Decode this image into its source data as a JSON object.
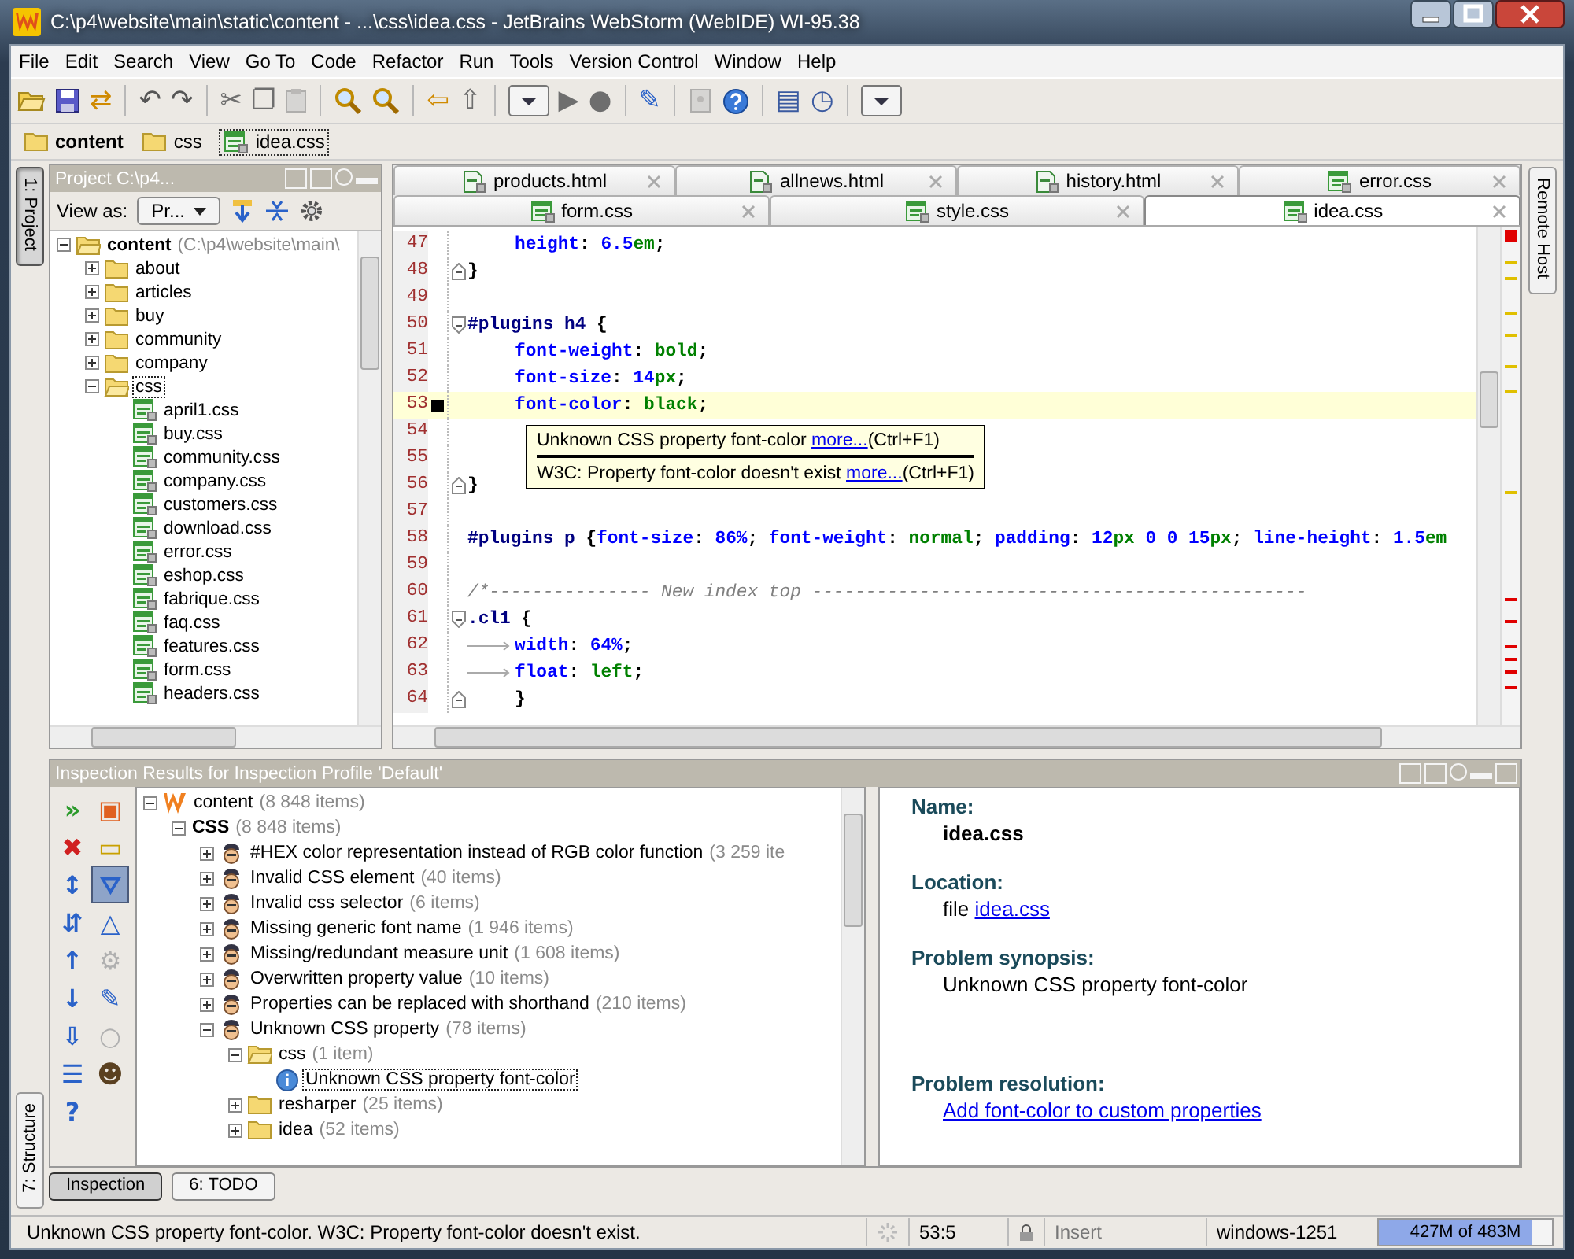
{
  "window": {
    "title": "C:\\p4\\website\\main\\static\\content - ...\\css\\idea.css - JetBrains WebStorm (WebIDE) WI-95.38"
  },
  "menu": [
    "File",
    "Edit",
    "Search",
    "View",
    "Go To",
    "Code",
    "Refactor",
    "Run",
    "Tools",
    "Version Control",
    "Window",
    "Help"
  ],
  "toolbar": [
    {
      "kind": "folder",
      "disabled": false
    },
    {
      "kind": "floppy",
      "disabled": false
    },
    {
      "kind": "glyph",
      "glyph": "⇄",
      "disabled": false
    },
    {
      "kind": "separator"
    },
    {
      "kind": "glyph",
      "glyph": "↶",
      "disabled": false
    },
    {
      "kind": "glyph",
      "glyph": "↷",
      "disabled": false
    },
    {
      "kind": "separator"
    },
    {
      "kind": "glyph",
      "glyph": "✂",
      "disabled": true
    },
    {
      "kind": "glyph",
      "glyph": "❐",
      "disabled": true
    },
    {
      "kind": "clipboard",
      "disabled": true
    },
    {
      "kind": "separator"
    },
    {
      "kind": "magnifier",
      "disabled": false
    },
    {
      "kind": "magnifier",
      "disabled": false
    },
    {
      "kind": "separator"
    },
    {
      "kind": "glyph",
      "glyph": "⇦",
      "disabled": false
    },
    {
      "kind": "glyph",
      "glyph": "⇧",
      "disabled": true
    },
    {
      "kind": "separator"
    },
    {
      "kind": "dropdown",
      "disabled": false
    },
    {
      "kind": "glyph",
      "glyph": "▶",
      "disabled": true
    },
    {
      "kind": "glyph",
      "glyph": "●",
      "disabled": true
    },
    {
      "kind": "separator"
    },
    {
      "kind": "glyph",
      "glyph": "✎",
      "disabled": false
    },
    {
      "kind": "separator"
    },
    {
      "kind": "document",
      "disabled": true
    },
    {
      "kind": "help",
      "disabled": false
    },
    {
      "kind": "separator"
    },
    {
      "kind": "glyph",
      "glyph": "▤",
      "disabled": false
    },
    {
      "kind": "glyph",
      "glyph": "◷",
      "disabled": false
    },
    {
      "kind": "separator"
    },
    {
      "kind": "dropdown",
      "disabled": false
    }
  ],
  "breadcrumbs": [
    {
      "label": "content",
      "kind": "folder"
    },
    {
      "label": "css",
      "kind": "folder"
    },
    {
      "label": "idea.css",
      "kind": "file"
    }
  ],
  "side_tabs": {
    "left_top": {
      "label": "1: Project",
      "selected": true
    },
    "left_bottom": {
      "label": "7: Structure",
      "selected": false
    },
    "right": {
      "label": "Remote Host",
      "selected": false
    }
  },
  "project": {
    "title": "Project C:\\p4...",
    "view_as_label": "View as:",
    "view_as_value": "Pr...",
    "tree": [
      {
        "label": "content",
        "path": "(C:\\p4\\website\\main\\",
        "kind": "folder",
        "expanded": true,
        "selected": false,
        "children": [
          {
            "label": "about",
            "kind": "folder",
            "expanded": false,
            "selected": false
          },
          {
            "label": "articles",
            "kind": "folder",
            "expanded": false,
            "selected": false
          },
          {
            "label": "buy",
            "kind": "folder",
            "expanded": false,
            "selected": false
          },
          {
            "label": "community",
            "kind": "folder",
            "expanded": false,
            "selected": false
          },
          {
            "label": "company",
            "kind": "folder",
            "expanded": false,
            "selected": false
          },
          {
            "label": "css",
            "kind": "folder",
            "expanded": true,
            "selected": true,
            "children": [
              {
                "label": "april1.css",
                "kind": "file",
                "selected": false
              },
              {
                "label": "buy.css",
                "kind": "file",
                "selected": false
              },
              {
                "label": "community.css",
                "kind": "file",
                "selected": false
              },
              {
                "label": "company.css",
                "kind": "file",
                "selected": false
              },
              {
                "label": "customers.css",
                "kind": "file",
                "selected": false
              },
              {
                "label": "download.css",
                "kind": "file",
                "selected": false
              },
              {
                "label": "error.css",
                "kind": "file",
                "selected": false
              },
              {
                "label": "eshop.css",
                "kind": "file",
                "selected": false
              },
              {
                "label": "fabrique.css",
                "kind": "file",
                "selected": false
              },
              {
                "label": "faq.css",
                "kind": "file",
                "selected": false
              },
              {
                "label": "features.css",
                "kind": "file",
                "selected": false
              },
              {
                "label": "form.css",
                "kind": "file",
                "selected": false
              },
              {
                "label": "headers.css",
                "kind": "file",
                "selected": false
              }
            ]
          }
        ]
      }
    ]
  },
  "editor": {
    "tab_rows": [
      [
        {
          "label": "products.html",
          "kind": "html",
          "selected": false
        },
        {
          "label": "allnews.html",
          "kind": "html",
          "selected": false
        },
        {
          "label": "history.html",
          "kind": "html",
          "selected": false
        },
        {
          "label": "error.css",
          "kind": "css",
          "selected": false
        }
      ],
      [
        {
          "label": "form.css",
          "kind": "css",
          "selected": false
        },
        {
          "label": "style.css",
          "kind": "css",
          "selected": false
        },
        {
          "label": "idea.css",
          "kind": "css",
          "selected": true
        }
      ]
    ],
    "lines": [
      {
        "number": "47",
        "indented": true,
        "segments": [
          {
            "kind": "prop",
            "text": "height"
          },
          {
            "kind": "punct",
            "text": ": "
          },
          {
            "kind": "num",
            "text": "6.5"
          },
          {
            "kind": "val",
            "text": "em"
          },
          {
            "kind": "punct",
            "text": ";"
          }
        ]
      },
      {
        "number": "48",
        "fold_end": true,
        "segments": [
          {
            "kind": "punct",
            "text": "}"
          }
        ]
      },
      {
        "number": "49"
      },
      {
        "number": "50",
        "fold_start": true,
        "segments": [
          {
            "kind": "sel",
            "text": "#plugins h4"
          },
          {
            "kind": "punct",
            "text": " {"
          }
        ]
      },
      {
        "number": "51",
        "indented": true,
        "segments": [
          {
            "kind": "prop",
            "text": "font-weight"
          },
          {
            "kind": "punct",
            "text": ": "
          },
          {
            "kind": "val",
            "text": "bold"
          },
          {
            "kind": "punct",
            "text": ";"
          }
        ]
      },
      {
        "number": "52",
        "indented": true,
        "segments": [
          {
            "kind": "prop",
            "text": "font-size"
          },
          {
            "kind": "punct",
            "text": ": "
          },
          {
            "kind": "num",
            "text": "14"
          },
          {
            "kind": "val",
            "text": "px"
          },
          {
            "kind": "punct",
            "text": ";"
          }
        ]
      },
      {
        "number": "53",
        "indented": true,
        "current": true,
        "segments": [
          {
            "kind": "prop",
            "text": "font-color"
          },
          {
            "kind": "punct",
            "text": ": "
          },
          {
            "kind": "val",
            "text": "black"
          },
          {
            "kind": "punct",
            "text": ";"
          }
        ]
      },
      {
        "number": "54"
      },
      {
        "number": "55"
      },
      {
        "number": "56",
        "fold_end": true,
        "segments": [
          {
            "kind": "punct",
            "text": "}"
          }
        ]
      },
      {
        "number": "57"
      },
      {
        "number": "58",
        "segments": [
          {
            "kind": "sel",
            "text": "#plugins p"
          },
          {
            "kind": "punct",
            "text": " {"
          },
          {
            "kind": "prop",
            "text": "font-size"
          },
          {
            "kind": "punct",
            "text": ": "
          },
          {
            "kind": "num",
            "text": "86%"
          },
          {
            "kind": "punct",
            "text": "; "
          },
          {
            "kind": "prop",
            "text": "font-weight"
          },
          {
            "kind": "punct",
            "text": ": "
          },
          {
            "kind": "val",
            "text": "normal"
          },
          {
            "kind": "punct",
            "text": "; "
          },
          {
            "kind": "prop",
            "text": "padding"
          },
          {
            "kind": "punct",
            "text": ": "
          },
          {
            "kind": "num",
            "text": "12"
          },
          {
            "kind": "val",
            "text": "px "
          },
          {
            "kind": "num",
            "text": "0 0 15"
          },
          {
            "kind": "val",
            "text": "px"
          },
          {
            "kind": "punct",
            "text": "; "
          },
          {
            "kind": "prop",
            "text": "line-height"
          },
          {
            "kind": "punct",
            "text": ": "
          },
          {
            "kind": "num",
            "text": "1.5"
          },
          {
            "kind": "val",
            "text": "em"
          }
        ]
      },
      {
        "number": "59"
      },
      {
        "number": "60",
        "segments": [
          {
            "kind": "comment",
            "text": "/*--------------- New index top ----------------------------------------------"
          }
        ]
      },
      {
        "number": "61",
        "fold_start": true,
        "segments": [
          {
            "kind": "sel",
            "text": ".cl1"
          },
          {
            "kind": "punct",
            "text": " {"
          }
        ]
      },
      {
        "number": "62",
        "tab": true,
        "segments": [
          {
            "kind": "prop",
            "text": "width"
          },
          {
            "kind": "punct",
            "text": ": "
          },
          {
            "kind": "num",
            "text": "64%"
          },
          {
            "kind": "punct",
            "text": ";"
          }
        ]
      },
      {
        "number": "63",
        "tab": true,
        "segments": [
          {
            "kind": "prop",
            "text": "float"
          },
          {
            "kind": "punct",
            "text": ": "
          },
          {
            "kind": "val",
            "text": "left"
          },
          {
            "kind": "punct",
            "text": ";"
          }
        ]
      },
      {
        "number": "64",
        "indented": true,
        "fold_end": true,
        "segments": [
          {
            "kind": "punct",
            "text": "}"
          }
        ]
      }
    ],
    "tooltip": [
      {
        "text": "Unknown CSS property font-color",
        "link": "more...",
        "shortcut": "(Ctrl+F1)"
      },
      {
        "text": "W3C: Property font-color doesn't exist",
        "link": "more...",
        "shortcut": "(Ctrl+F1)"
      }
    ]
  },
  "inspection": {
    "title": "Inspection Results for Inspection Profile 'Default'",
    "tools": [
      {
        "glyph": "»",
        "disabled": false,
        "selected": false
      },
      {
        "glyph": "▣",
        "disabled": false,
        "selected": false
      },
      {
        "glyph": "✖",
        "disabled": false,
        "selected": false
      },
      {
        "glyph": "▭",
        "disabled": false,
        "selected": false
      },
      {
        "glyph": "↕",
        "disabled": false,
        "selected": false
      },
      {
        "glyph": "⛛",
        "disabled": false,
        "selected": true
      },
      {
        "glyph": "⇵",
        "disabled": false,
        "selected": false
      },
      {
        "glyph": "△",
        "disabled": false,
        "selected": false
      },
      {
        "glyph": "↑",
        "disabled": false,
        "selected": false
      },
      {
        "glyph": "⚙",
        "disabled": true,
        "selected": false
      },
      {
        "glyph": "↓",
        "disabled": false,
        "selected": false
      },
      {
        "glyph": "✎",
        "disabled": false,
        "selected": false
      },
      {
        "glyph": "⇩",
        "disabled": false,
        "selected": false
      },
      {
        "glyph": "○",
        "disabled": true,
        "selected": false
      },
      {
        "glyph": "☰",
        "disabled": false,
        "selected": false
      },
      {
        "glyph": "☻",
        "disabled": false,
        "selected": false
      },
      {
        "glyph": "?",
        "disabled": false,
        "selected": false
      }
    ],
    "tree": [
      {
        "label": "content",
        "count": "(8 848 items)",
        "kind": "root",
        "expanded": true,
        "selected": false,
        "children": [
          {
            "label": "CSS",
            "count": "(8 848 items)",
            "kind": "group",
            "expanded": true,
            "selected": false,
            "children": [
              {
                "label": "#HEX color representation instead of RGB color function",
                "count": "(3 259 ite",
                "kind": "inspection",
                "expanded": false,
                "selected": false
              },
              {
                "label": "Invalid CSS element",
                "count": "(40 items)",
                "kind": "inspection",
                "expanded": false,
                "selected": false
              },
              {
                "label": "Invalid css selector",
                "count": "(6 items)",
                "kind": "inspection",
                "expanded": false,
                "selected": false
              },
              {
                "label": "Missing generic font name",
                "count": "(1 946 items)",
                "kind": "inspection",
                "expanded": false,
                "selected": false
              },
              {
                "label": "Missing/redundant measure unit",
                "count": "(1 608 items)",
                "kind": "inspection",
                "expanded": false,
                "selected": false
              },
              {
                "label": "Overwritten property value",
                "count": "(10 items)",
                "kind": "inspection",
                "expanded": false,
                "selected": false
              },
              {
                "label": "Properties can be replaced with shorthand",
                "count": "(210 items)",
                "kind": "inspection",
                "expanded": false,
                "selected": false
              },
              {
                "label": "Unknown CSS property",
                "count": "(78 items)",
                "kind": "inspection",
                "expanded": true,
                "selected": false,
                "children": [
                  {
                    "label": "css",
                    "count": "(1 item)",
                    "kind": "folder",
                    "expanded": true,
                    "selected": false,
                    "children": [
                      {
                        "label": "Unknown CSS property font-color",
                        "kind": "problem",
                        "selected": true
                      }
                    ]
                  },
                  {
                    "label": "resharper",
                    "count": "(25 items)",
                    "kind": "folder",
                    "expanded": false,
                    "selected": false
                  },
                  {
                    "label": "idea",
                    "count": "(52 items)",
                    "kind": "folder",
                    "expanded": false,
                    "selected": false
                  }
                ]
              }
            ]
          }
        ]
      }
    ],
    "details": [
      {
        "heading": "Name:",
        "value": "idea.css",
        "kind": "bold"
      },
      {
        "heading": "Location:",
        "prefix": "file",
        "link": "idea.css",
        "kind": "file-link"
      },
      {
        "heading": "Problem synopsis:",
        "value": "Unknown CSS property font-color",
        "kind": "text"
      },
      {
        "heading": "Problem resolution:",
        "link": "Add font-color to custom properties",
        "kind": "link"
      }
    ]
  },
  "tool_buttons": [
    {
      "label": "Inspection",
      "selected": true
    },
    {
      "label": "6: TODO",
      "selected": false
    }
  ],
  "status_bar": {
    "message": "Unknown CSS property font-color. W3C: Property font-color doesn't exist.",
    "position": "53:5",
    "mode": "Insert",
    "encoding": "windows-1251",
    "memory": {
      "text": "427M of 483M",
      "level": 0.88
    }
  }
}
